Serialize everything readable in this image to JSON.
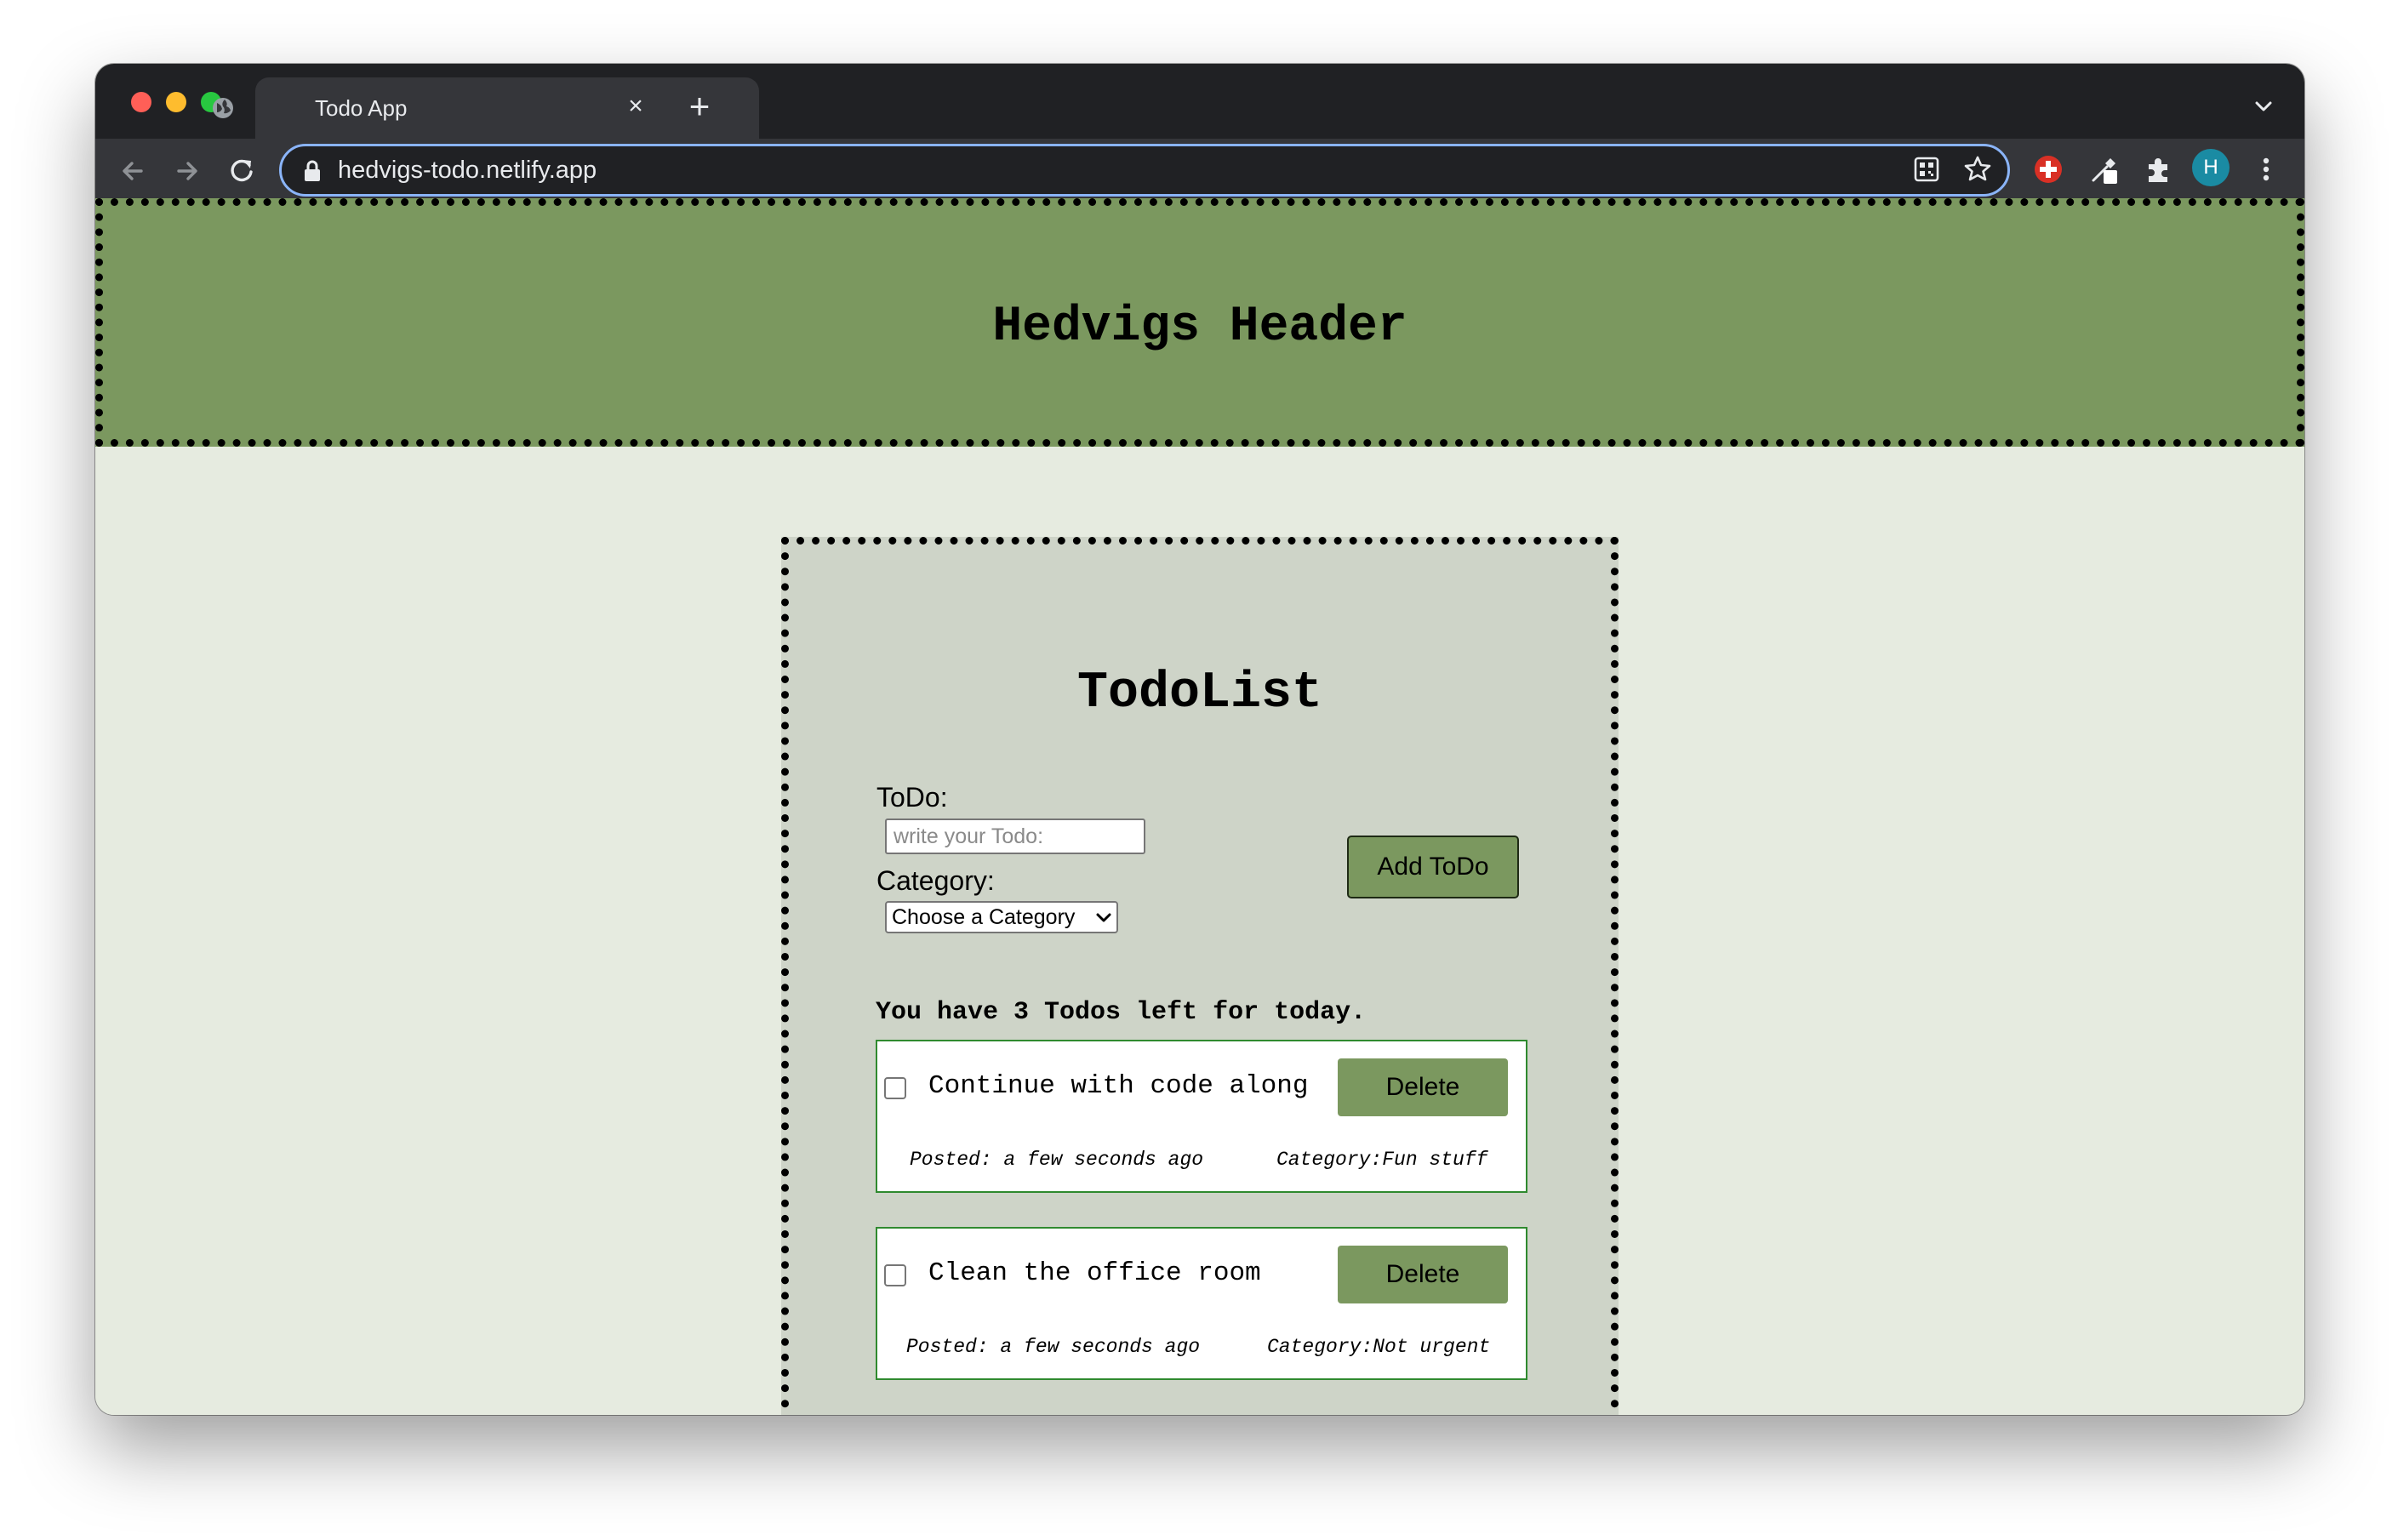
{
  "browser": {
    "tab_title": "Todo App",
    "url": "hedvigs-todo.netlify.app",
    "profile_initial": "H",
    "accent_color": "#8ab4f8"
  },
  "page": {
    "header_title": "Hedvigs Header",
    "list_title": "TodoList",
    "form": {
      "todo_label": "ToDo:",
      "todo_placeholder": "write your Todo:",
      "todo_value": "",
      "category_label": "Category:",
      "category_selected": "Choose a Category",
      "add_button": "Add ToDo"
    },
    "todos_left_text": "You have 3 Todos left for today.",
    "todos": [
      {
        "text": "Continue with code along",
        "done": false,
        "delete_label": "Delete",
        "posted": "Posted: a few seconds ago",
        "category": "Category:Fun stuff"
      },
      {
        "text": "Clean the office room",
        "done": false,
        "delete_label": "Delete",
        "posted": "Posted: a few seconds ago",
        "category": "Category:Not urgent"
      }
    ],
    "colors": {
      "header_bg": "#7b985f",
      "page_bg": "#e6ebe0",
      "container_bg": "#ced4c8",
      "card_border": "#2f8a2f"
    }
  }
}
